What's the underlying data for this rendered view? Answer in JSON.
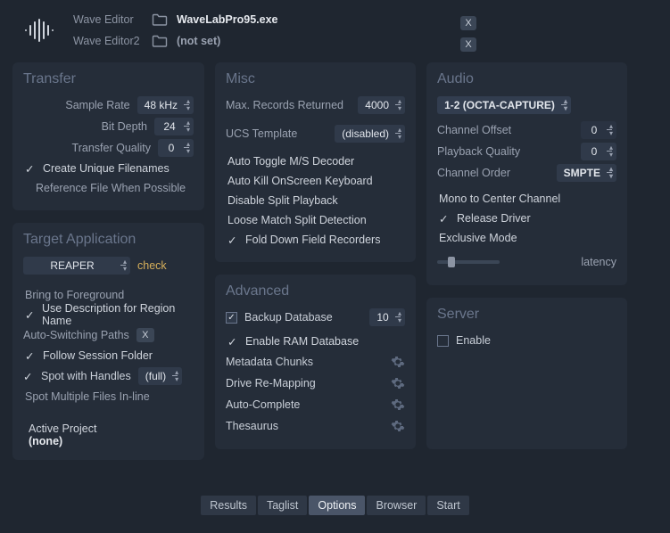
{
  "editors": {
    "row1_label": "Wave Editor",
    "row1_value": "WaveLabPro95.exe",
    "row2_label": "Wave Editor2",
    "row2_value": "(not set)",
    "x_badge": "X"
  },
  "transfer": {
    "title": "Transfer",
    "sample_rate_label": "Sample Rate",
    "sample_rate_value": "48 kHz",
    "bit_depth_label": "Bit Depth",
    "bit_depth_value": "24",
    "quality_label": "Transfer  Quality",
    "quality_value": "0",
    "opt1": "Create Unique Filenames",
    "opt2": "Reference File When Possible"
  },
  "target": {
    "title": "Target Application",
    "app_value": "REAPER",
    "check_link": "check",
    "bring": "Bring to Foreground",
    "use_desc": "Use Description for Region Name",
    "auto_switch": "Auto-Switching Paths",
    "x": "X",
    "follow": "Follow Session Folder",
    "spot_handles": "Spot with Handles",
    "spot_handles_value": "(full)",
    "spot_multi": "Spot Multiple Files In-line",
    "active_project_h": "Active Project",
    "active_project_v": "(none)"
  },
  "misc": {
    "title": "Misc",
    "max_rec_label": "Max. Records Returned",
    "max_rec_value": "4000",
    "ucs_label": "UCS Template",
    "ucs_value": "(disabled)",
    "o1": "Auto Toggle M/S Decoder",
    "o2": "Auto Kill OnScreen Keyboard",
    "o3": "Disable Split Playback",
    "o4": "Loose Match Split Detection",
    "o5": "Fold Down Field Recorders"
  },
  "advanced": {
    "title": "Advanced",
    "backup": "Backup Database",
    "backup_value": "10",
    "ram": "Enable RAM Database",
    "meta": "Metadata Chunks",
    "drive": "Drive Re-Mapping",
    "auto": "Auto-Complete",
    "thes": "Thesaurus"
  },
  "audio": {
    "title": "Audio",
    "device": "1-2 (OCTA-CAPTURE)",
    "ch_offset_label": "Channel Offset",
    "ch_offset_value": "0",
    "pb_quality_label": "Playback Quality",
    "pb_quality_value": "0",
    "ch_order_label": "Channel Order",
    "ch_order_value": "SMPTE",
    "mono": "Mono to Center Channel",
    "release": "Release Driver",
    "exclusive": "Exclusive Mode",
    "latency": "latency"
  },
  "server": {
    "title": "Server",
    "enable": "Enable"
  },
  "tabs": {
    "results": "Results",
    "taglist": "Taglist",
    "options": "Options",
    "browser": "Browser",
    "start": "Start"
  }
}
